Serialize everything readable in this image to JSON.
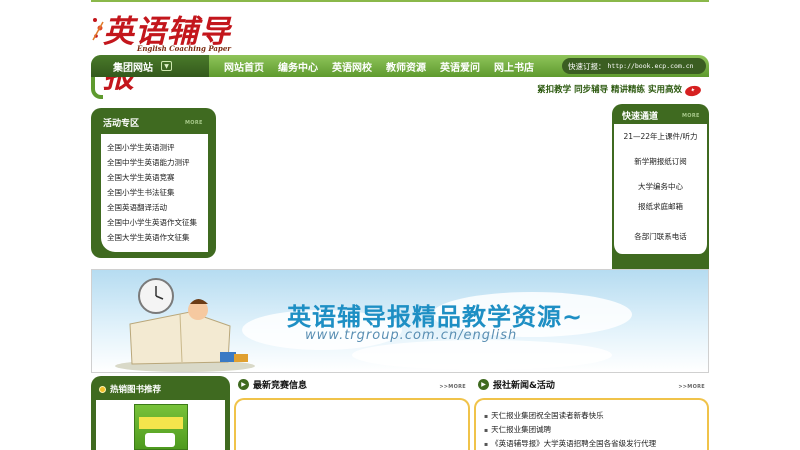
{
  "logo": {
    "title_cn": "英语辅导报",
    "title_en": "English Coaching Paper"
  },
  "nav": {
    "group_label": "集团网站",
    "links": [
      "网站首页",
      "编务中心",
      "英语网校",
      "教师资源",
      "英语爱问",
      "网上书店"
    ],
    "subscribe_label": "快速订报：",
    "subscribe_url": "http://book.ecp.com.cn",
    "slogan": "紧扣教学 同步辅导 精讲精练 实用高效"
  },
  "activities": {
    "title": "活动专区",
    "more": "MORE",
    "items": [
      "全国小学生英语测评",
      "全国中学生英语能力测评",
      "全国大学生英语竞赛",
      "全国小学生书法征集",
      "全国英语翻译活动",
      "全国中小学生英语作文征集",
      "全国大学生英语作文征集"
    ]
  },
  "quick": {
    "title": "快速通道",
    "more": "MORE",
    "items": [
      "21—22年上课件/听力",
      "新学期报纸订阅",
      "大学编务中心",
      "报纸求庭邮箱",
      "各部门联系电话"
    ]
  },
  "banner": {
    "title_cn": "英语辅导报精品教学资源~",
    "url": "www.trgroup.com.cn/english"
  },
  "bestseller": {
    "title": "热销图书推荐"
  },
  "latest_contest": {
    "title": "最新竞赛信息",
    "more": "MORE",
    "items": []
  },
  "news": {
    "title": "报社新闻&活动",
    "more": "MORE",
    "items": [
      "天仁报业集团祝全国读者新春快乐",
      "天仁报业集团诚聘",
      "《英语辅导报》大学英语招聘全国各省级发行代理"
    ]
  },
  "colors": {
    "dark_green": "#3f6a20",
    "light_green": "#8fc45a",
    "accent_red": "#c3161c",
    "gold": "#f0c34a"
  }
}
